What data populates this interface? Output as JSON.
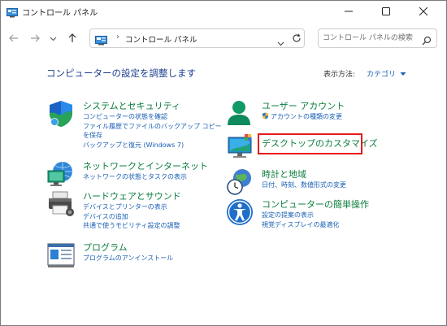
{
  "window": {
    "title": "コントロール パネル",
    "controls": [
      "minimize",
      "maximize",
      "close"
    ]
  },
  "nav": {
    "breadcrumb": "コントロール パネル",
    "search_placeholder": "コントロール パネルの検索"
  },
  "heading": "コンピューターの設定を調整します",
  "view_by": {
    "label": "表示方法:",
    "value": "カテゴリ"
  },
  "categories": {
    "system": {
      "title": "システムとセキュリティ",
      "icon": "shield-icon",
      "links": [
        "コンピューターの状態を確認",
        "ファイル履歴でファイルのバックアップ コピーを保存",
        "バックアップと復元 (Windows 7)"
      ]
    },
    "network": {
      "title": "ネットワークとインターネット",
      "icon": "network-icon",
      "links": [
        "ネットワークの状態とタスクの表示"
      ]
    },
    "hardware": {
      "title": "ハードウェアとサウンド",
      "icon": "printer-icon",
      "links": [
        "デバイスとプリンターの表示",
        "デバイスの追加",
        "共通で使うモビリティ設定の調整"
      ]
    },
    "programs": {
      "title": "プログラム",
      "icon": "programs-icon",
      "links": [
        "プログラムのアンインストール"
      ]
    },
    "user": {
      "title": "ユーザー アカウント",
      "icon": "user-icon",
      "links": [
        "アカウントの種類の変更"
      ]
    },
    "desktop": {
      "title": "デスクトップのカスタマイズ",
      "icon": "desktop-icon",
      "links": []
    },
    "clock": {
      "title": "時計と地域",
      "icon": "clock-globe-icon",
      "links": [
        "日付、時刻、数値形式の変更"
      ]
    },
    "access": {
      "title": "コンピューターの簡単操作",
      "icon": "accessibility-icon",
      "links": [
        "設定の提案の表示",
        "視覚ディスプレイの最適化"
      ]
    }
  },
  "colors": {
    "category_title": "#0a7d3c",
    "link": "#1a5fb4",
    "heading": "#1b3f8e",
    "highlight": "#e8191b"
  }
}
